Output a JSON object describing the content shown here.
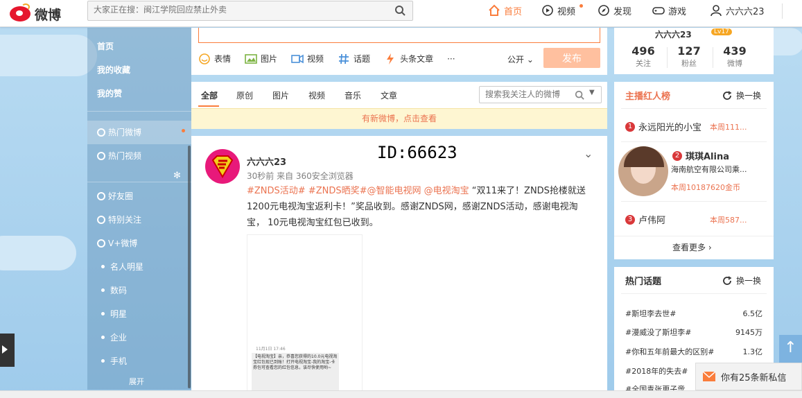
{
  "header": {
    "logo_text": "微博",
    "search_placeholder": "大家正在搜：闽江学院回应禁止外卖",
    "nav": {
      "home": "首页",
      "video": "视频",
      "discover": "发现",
      "game": "游戏",
      "user": "六六六23"
    }
  },
  "leftnav": {
    "items": [
      "首页",
      "我的收藏",
      "我的赞"
    ],
    "hot_weibo": "热门微博",
    "hot_video": "热门视频",
    "friends": "好友圈",
    "special": "特别关注",
    "vplus": "V+微博",
    "groups": [
      "名人明星",
      "数码",
      "明星",
      "企业",
      "手机"
    ],
    "expand": "展开"
  },
  "composer": {
    "tools": [
      "表情",
      "图片",
      "视频",
      "话题",
      "头条文章"
    ],
    "more": "···",
    "scope": "公开",
    "publish": "发布"
  },
  "feed_tabs": {
    "tabs": [
      "全部",
      "原创",
      "图片",
      "视频",
      "音乐",
      "文章"
    ],
    "search_placeholder": "搜索我关注人的微博",
    "notice": "有新微博，点击查看"
  },
  "post": {
    "username": "六六六23",
    "meta": "30秒前 来自 360安全浏览器",
    "id_label": "ID:66623",
    "tags": "#ZNDS活动# #ZNDS晒奖#@智能电视网 @电视淘宝",
    "text": " “双11来了！ZNDS抢楼就送1200元电视淘宝返利卡！”奖品收到。感谢ZNDS网，感谢ZNDS活动，感谢电视淘宝， 10元电视淘宝红包已收到。",
    "shot_time": "11月1日 17:46",
    "shot_text": "【电视淘宝】亲，恭喜您获得的10.0元电视淘宝红包现已到账！打开电视淘宝-我的淘宝-卡券包可查看您的红包信息，该尽快使用哟~"
  },
  "profile": {
    "name": "六六六23",
    "level": "Lv17",
    "stats": [
      {
        "n": "496",
        "l": "关注"
      },
      {
        "n": "127",
        "l": "粉丝"
      },
      {
        "n": "439",
        "l": "微博"
      }
    ]
  },
  "anchors": {
    "title": "主播红人榜",
    "refresh": "换一换",
    "list": [
      {
        "rank": "1",
        "name": "永远阳光的小宝",
        "val": "本周111..."
      },
      {
        "rank": "2",
        "name": "琪琪Alina",
        "sub": "海南航空有限公司乘...",
        "val": "本周10187620金币"
      },
      {
        "rank": "3",
        "name": "卢伟阿",
        "val": "本周587..."
      }
    ],
    "more": "查看更多 ›"
  },
  "topics": {
    "title": "热门话题",
    "refresh": "换一换",
    "list": [
      {
        "t": "#斯坦李去世#",
        "v": "6.5亿"
      },
      {
        "t": "#漫威没了斯坦李#",
        "v": "9145万"
      },
      {
        "t": "#你和五年前最大的区别#",
        "v": "1.3亿"
      },
      {
        "t": "#2018年的失去#",
        "v": ""
      },
      {
        "t": "#全国青张更子啻",
        "v": ""
      }
    ]
  },
  "pm": {
    "text": "你有25条新私信"
  },
  "colors": {
    "accent": "#fa7d3c",
    "link": "#eb7350",
    "sky": "#aed3ee"
  }
}
